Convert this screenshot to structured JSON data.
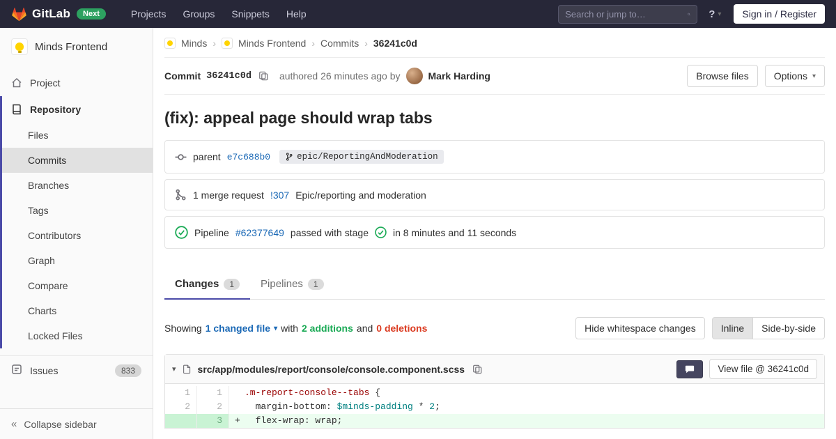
{
  "colors": {
    "header_bg": "#272738",
    "accent_indigo": "#4b4ba8",
    "link_blue": "#1b69b6",
    "addition_green": "#1aaa55",
    "deletion_red": "#db3b21",
    "next_badge_green": "#2da160",
    "added_line_bg": "#ecfdf0"
  },
  "glyphs": {
    "caret_down": "▾"
  },
  "header": {
    "logo_text": "GitLab",
    "next_badge": "Next",
    "nav": [
      "Projects",
      "Groups",
      "Snippets",
      "Help"
    ],
    "search_placeholder": "Search or jump to…",
    "help_glyph": "?",
    "sign_in": "Sign in / Register"
  },
  "sidebar": {
    "project_name": "Minds Frontend",
    "project_item": "Project",
    "repository_item": "Repository",
    "repo_subitems": [
      "Files",
      "Commits",
      "Branches",
      "Tags",
      "Contributors",
      "Graph",
      "Compare",
      "Charts",
      "Locked Files"
    ],
    "issues_label": "Issues",
    "issues_count": "833",
    "collapse_label": "Collapse sidebar",
    "collapse_glyph": "«"
  },
  "breadcrumb": {
    "minds": "Minds",
    "minds_frontend": "Minds Frontend",
    "commits": "Commits",
    "sha": "36241c0d",
    "separator": "›"
  },
  "commit": {
    "label": "Commit",
    "sha": "36241c0d",
    "authored": "authored 26 minutes ago by",
    "author": "Mark Harding",
    "browse_files": "Browse files",
    "options": "Options",
    "title": "(fix): appeal page should wrap tabs"
  },
  "parent_row": {
    "label": "parent",
    "sha": "e7c688b0",
    "branch": "epic/ReportingAndModeration"
  },
  "mr_row": {
    "count_label": "1 merge request",
    "ref": "!307",
    "title": "Epic/reporting and moderation"
  },
  "pipeline_row": {
    "label": "Pipeline",
    "id": "#62377649",
    "status": "passed with stage",
    "duration": "in 8 minutes and 11 seconds"
  },
  "tabs": {
    "changes": {
      "label": "Changes",
      "count": "1"
    },
    "pipelines": {
      "label": "Pipelines",
      "count": "1"
    }
  },
  "showing": {
    "prefix": "Showing",
    "files": "1 changed file",
    "with_word": "with",
    "additions": "2 additions",
    "and_word": "and",
    "deletions": "0 deletions",
    "hide_whitespace": "Hide whitespace changes",
    "inline": "Inline",
    "side_by_side": "Side-by-side"
  },
  "diff": {
    "file_path": "src/app/modules/report/console/console.component.scss",
    "view_file": "View file @ 36241c0d",
    "lines": [
      {
        "old": "1",
        "new": "1",
        "sign": "",
        "sel": ".m-report-console--tabs",
        "rest": " {"
      },
      {
        "old": "2",
        "new": "2",
        "sign": "",
        "pre": "  margin-bottom: ",
        "var": "$minds-padding",
        "op": " * ",
        "num": "2",
        "post": ";"
      },
      {
        "old": "",
        "new": "3",
        "sign": "+",
        "code": "  flex-wrap: wrap;"
      }
    ]
  }
}
